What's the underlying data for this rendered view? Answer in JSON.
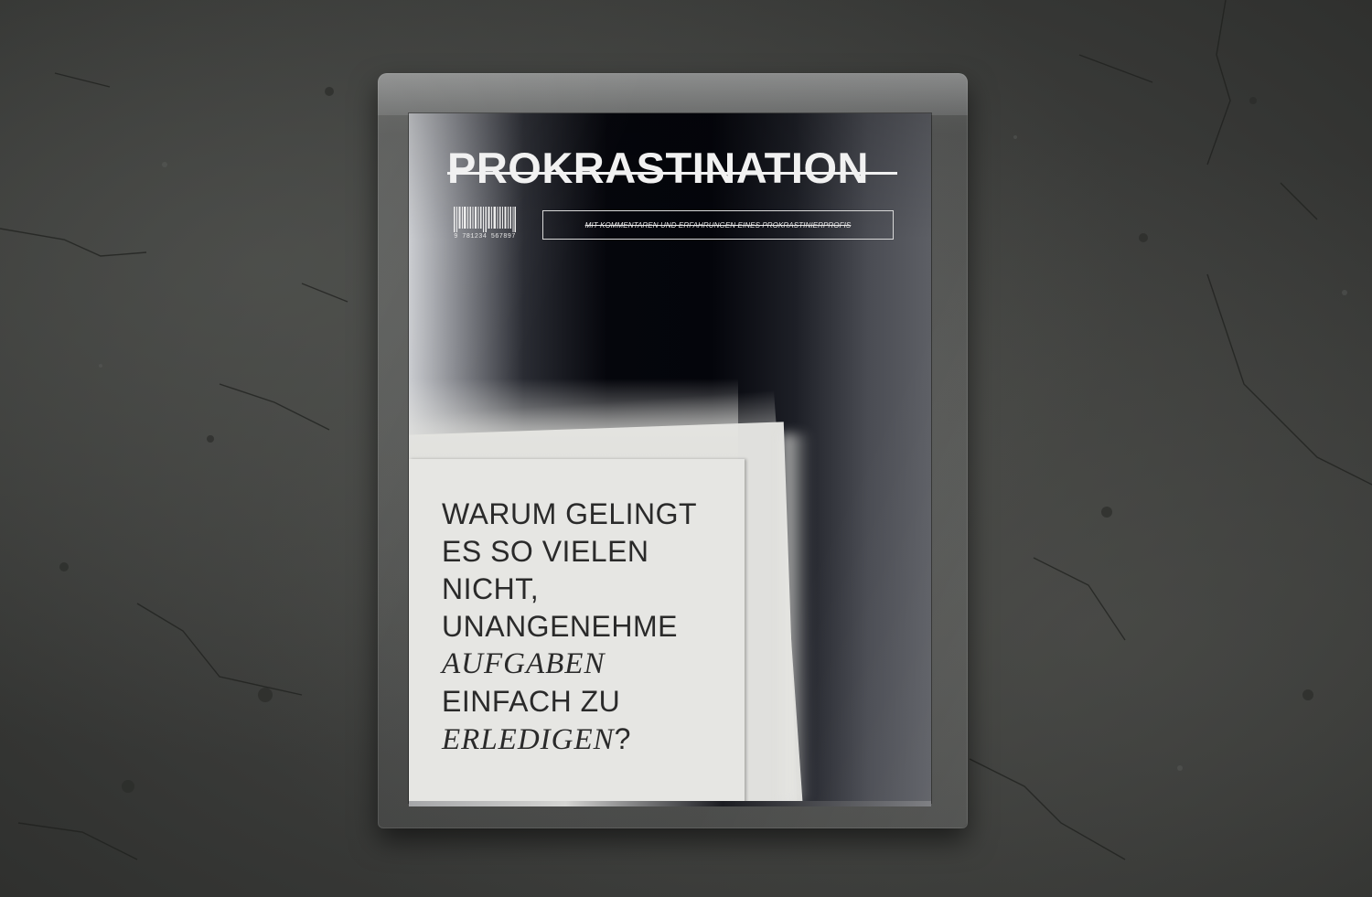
{
  "scene": {
    "background_color": "#3e3f3d"
  },
  "magazine": {
    "title": "PROKRASTINATION",
    "subtitle": "MIT KOMMENTAREN UND ERFAHRUNGEN EINES PROKRASTINIERPROFIS",
    "barcode_number": "9 781234 567897",
    "headline": {
      "line1": "WARUM GELINGT",
      "line2": "ES SO VIELEN",
      "line3": "NICHT,",
      "line4": "UNANGENEHME",
      "line5": "AUFGABEN",
      "line6": "EINFACH ZU",
      "line7_serif": "ERLEDIGEN",
      "line7_punct": "?"
    },
    "colors": {
      "cover_dark": "#04050b",
      "paper": "#e6e6e3",
      "title_text": "#f1f1f1",
      "headline_text": "#2a2a2a"
    }
  }
}
